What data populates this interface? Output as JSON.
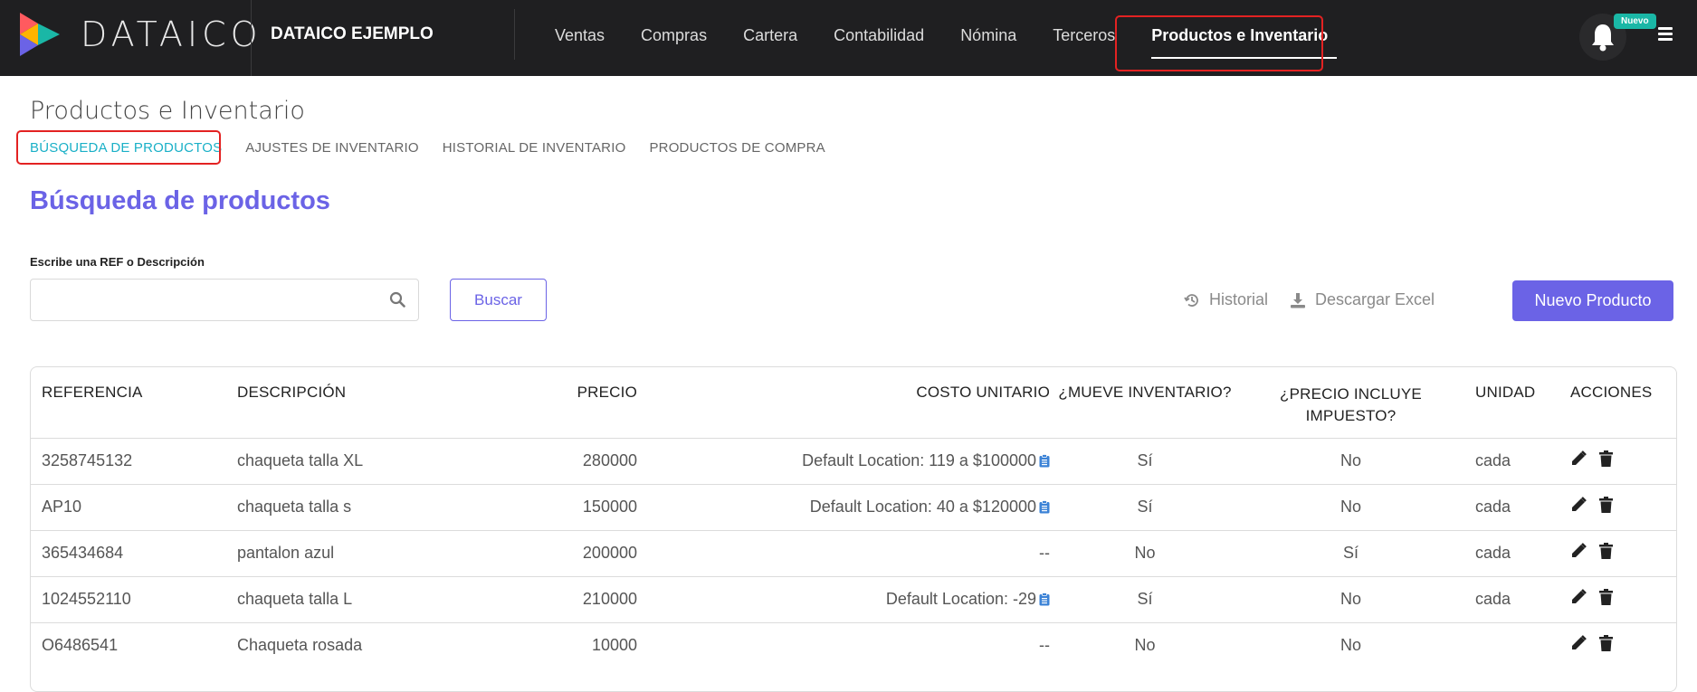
{
  "brand": {
    "name": "DATAICO",
    "company": "DATAICO EJEMPLO"
  },
  "nav": {
    "items": [
      "Ventas",
      "Compras",
      "Cartera",
      "Contabilidad",
      "Nómina",
      "Terceros",
      "Productos e Inventario"
    ],
    "active": "Productos e Inventario"
  },
  "notifications": {
    "badge": "Nuevo",
    "icon": "bell-icon"
  },
  "page": {
    "title": "Productos e Inventario",
    "subtabs": [
      "BÚSQUEDA DE PRODUCTOS",
      "AJUSTES DE INVENTARIO",
      "HISTORIAL DE INVENTARIO",
      "PRODUCTOS DE COMPRA"
    ],
    "section_title": "Búsqueda de productos"
  },
  "search": {
    "label": "Escribe una REF o Descripción",
    "value": "",
    "placeholder": "",
    "button": "Buscar"
  },
  "actions": {
    "historial": "Historial",
    "excel": "Descargar Excel",
    "nuevo": "Nuevo Producto"
  },
  "table": {
    "headers": [
      "REFERENCIA",
      "DESCRIPCIÓN",
      "PRECIO",
      "COSTO UNITARIO",
      "¿MUEVE INVENTARIO?",
      "¿PRECIO INCLUYE IMPUESTO?",
      "UNIDAD",
      "ACCIONES"
    ],
    "rows": [
      {
        "ref": "3258745132",
        "desc": "chaqueta talla XL",
        "precio": "280000",
        "costo": "Default Location: 119 a $100000",
        "costo_icon": true,
        "mueve": "Sí",
        "incluye": "No",
        "unidad": "cada"
      },
      {
        "ref": "AP10",
        "desc": "chaqueta talla s",
        "precio": "150000",
        "costo": "Default Location: 40 a $120000",
        "costo_icon": true,
        "mueve": "Sí",
        "incluye": "No",
        "unidad": "cada"
      },
      {
        "ref": "365434684",
        "desc": "pantalon azul",
        "precio": "200000",
        "costo": "--",
        "costo_icon": false,
        "mueve": "No",
        "incluye": "Sí",
        "unidad": "cada"
      },
      {
        "ref": "1024552110",
        "desc": "chaqueta talla L",
        "precio": "210000",
        "costo": "Default Location: -29",
        "costo_icon": true,
        "mueve": "Sí",
        "incluye": "No",
        "unidad": "cada"
      },
      {
        "ref": "O6486541",
        "desc": "Chaqueta rosada",
        "precio": "10000",
        "costo": "--",
        "costo_icon": false,
        "mueve": "No",
        "incluye": "No",
        "unidad": ""
      }
    ]
  },
  "colors": {
    "topbar": "#1f1f21",
    "accent": "#6b63e6",
    "active_tab": "#1ab0c7",
    "highlight": "#e32222",
    "badge": "#1ab7a6"
  }
}
